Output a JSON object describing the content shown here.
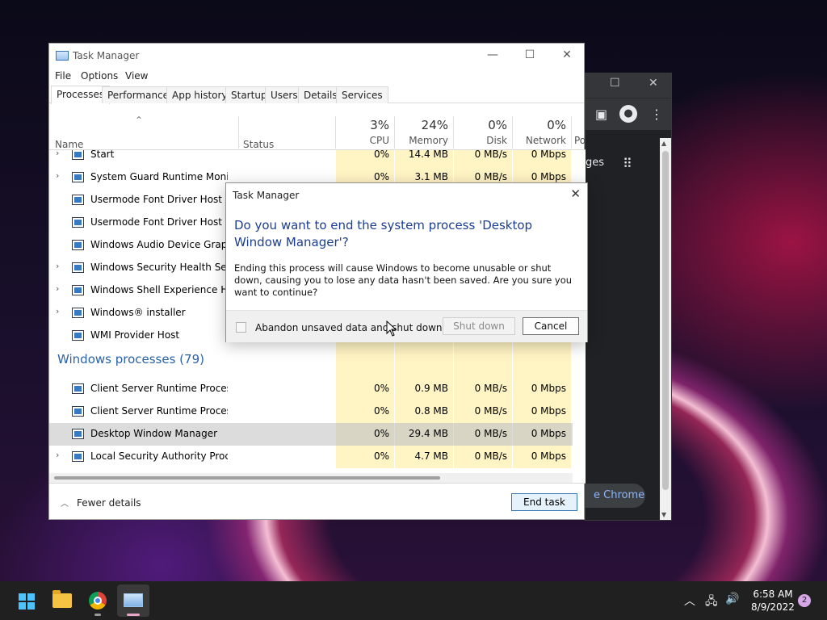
{
  "chrome": {
    "page_fragment": "ges",
    "pill_text": "e Chrome"
  },
  "task_manager": {
    "title": "Task Manager",
    "menu": [
      "File",
      "Options",
      "View"
    ],
    "tabs": [
      "Processes",
      "Performance",
      "App history",
      "Startup",
      "Users",
      "Details",
      "Services"
    ],
    "active_tab": "Processes",
    "columns": {
      "name": "Name",
      "status": "Status",
      "cpu": {
        "pct": "3%",
        "label": "CPU"
      },
      "memory": {
        "pct": "24%",
        "label": "Memory"
      },
      "disk": {
        "pct": "0%",
        "label": "Disk"
      },
      "network": {
        "pct": "0%",
        "label": "Network"
      },
      "power_partial": "Po"
    },
    "rows": [
      {
        "name": "Start",
        "expand": true,
        "cpu": "0%",
        "memory": "14.4 MB",
        "disk": "0 MB/s",
        "network": "0 Mbps"
      },
      {
        "name": "System Guard Runtime Monitor...",
        "expand": true,
        "cpu": "0%",
        "memory": "3.1 MB",
        "disk": "0 MB/s",
        "network": "0 Mbps"
      },
      {
        "name": "Usermode Font Driver Host",
        "expand": false,
        "cpu": "",
        "memory": "",
        "disk": "",
        "network": ""
      },
      {
        "name": "Usermode Font Driver Host",
        "expand": false,
        "cpu": "",
        "memory": "",
        "disk": "",
        "network": ""
      },
      {
        "name": "Windows Audio Device Graph Is",
        "expand": false,
        "cpu": "",
        "memory": "",
        "disk": "",
        "network": ""
      },
      {
        "name": "Windows Security Health Servic",
        "expand": true,
        "cpu": "",
        "memory": "",
        "disk": "",
        "network": ""
      },
      {
        "name": "Windows Shell Experience Host",
        "expand": true,
        "cpu": "",
        "memory": "",
        "disk": "",
        "network": ""
      },
      {
        "name": "Windows® installer",
        "expand": true,
        "cpu": "",
        "memory": "",
        "disk": "",
        "network": ""
      },
      {
        "name": "WMI Provider Host",
        "expand": false,
        "cpu": "",
        "memory": "",
        "disk": "",
        "network": ""
      }
    ],
    "group_header": "Windows processes (79)",
    "group_rows": [
      {
        "name": "Client Server Runtime Process",
        "expand": false,
        "cpu": "0%",
        "memory": "0.9 MB",
        "disk": "0 MB/s",
        "network": "0 Mbps"
      },
      {
        "name": "Client Server Runtime Process",
        "expand": false,
        "cpu": "0%",
        "memory": "0.8 MB",
        "disk": "0 MB/s",
        "network": "0 Mbps"
      },
      {
        "name": "Desktop Window Manager",
        "expand": false,
        "selected": true,
        "cpu": "0%",
        "memory": "29.4 MB",
        "disk": "0 MB/s",
        "network": "0 Mbps"
      },
      {
        "name": "Local Security Authority Process...",
        "expand": true,
        "cpu": "0%",
        "memory": "4.7 MB",
        "disk": "0 MB/s",
        "network": "0 Mbps"
      }
    ],
    "fewer_details": "Fewer details",
    "end_task": "End task"
  },
  "dialog": {
    "title": "Task Manager",
    "heading": "Do you want to end the system process 'Desktop Window Manager'?",
    "body": "Ending this process will cause Windows to become unusable or shut down, causing you to lose any data hasn't been saved. Are you sure you want to continue?",
    "checkbox_label": "Abandon unsaved data and shut down.",
    "shutdown_label": "Shut down",
    "cancel_label": "Cancel"
  },
  "taskbar": {
    "time": "6:58 AM",
    "date": "8/9/2022",
    "notifications": "2"
  },
  "colors": {
    "accent": "#2a62a8",
    "dialog_heading": "#1b3d91",
    "cell_highlight": "#fff4c4",
    "taskbar": "#202020"
  }
}
